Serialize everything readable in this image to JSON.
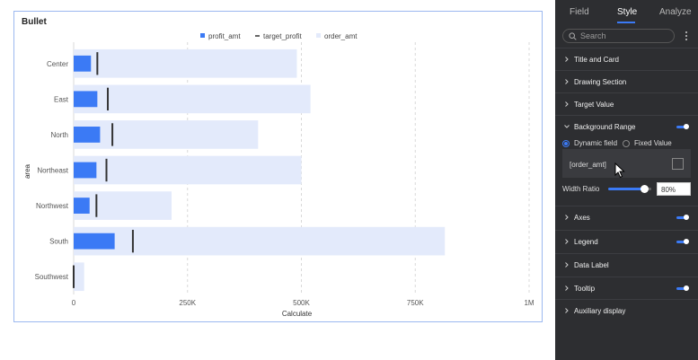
{
  "chart_data": {
    "type": "bar",
    "title": "Bullet",
    "xlabel": "Calculate",
    "ylabel": "area",
    "categories": [
      "Center",
      "East",
      "North",
      "Northeast",
      "Northwest",
      "South",
      "Southwest"
    ],
    "series": [
      {
        "name": "profit_amt",
        "values": [
          38000,
          52000,
          58000,
          50000,
          35000,
          90000,
          2000
        ]
      },
      {
        "name": "target_profit",
        "values": [
          52000,
          75000,
          85000,
          72000,
          50000,
          130000,
          0
        ]
      },
      {
        "name": "order_amt",
        "values": [
          490000,
          520000,
          405000,
          500000,
          215000,
          815000,
          23000
        ]
      }
    ],
    "xlim": [
      0,
      1000000
    ],
    "x_ticks": [
      "0",
      "250K",
      "500K",
      "750K",
      "1M"
    ],
    "x_tick_values": [
      0,
      250000,
      500000,
      750000,
      1000000
    ],
    "grid": true,
    "legend": "top-center",
    "colors": {
      "profit_amt": "#3b7af5",
      "target_profit": "#333333",
      "order_amt": "#e3eafb"
    }
  },
  "panel": {
    "tabs": [
      "Field",
      "Style",
      "Analyze"
    ],
    "active_tab": "Style",
    "search_placeholder": "Search",
    "sections": [
      {
        "label": "Title and Card",
        "toggle": false
      },
      {
        "label": "Drawing Section",
        "toggle": false
      },
      {
        "label": "Target Value",
        "toggle": false
      },
      {
        "label": "Background Range",
        "toggle": true,
        "expanded": true
      },
      {
        "label": "Axes",
        "toggle": true
      },
      {
        "label": "Legend",
        "toggle": true
      },
      {
        "label": "Data Label",
        "toggle": false
      },
      {
        "label": "Tooltip",
        "toggle": true
      },
      {
        "label": "Auxiliary display",
        "toggle": false
      }
    ],
    "background_range": {
      "radio_dynamic": "Dynamic field",
      "radio_fixed": "Fixed Value",
      "selected": "Dynamic field",
      "field": "[order_amt]",
      "width_ratio_label": "Width Ratio",
      "width_ratio": "80%",
      "width_ratio_value": 0.8
    },
    "accent": "#3b7af5"
  }
}
